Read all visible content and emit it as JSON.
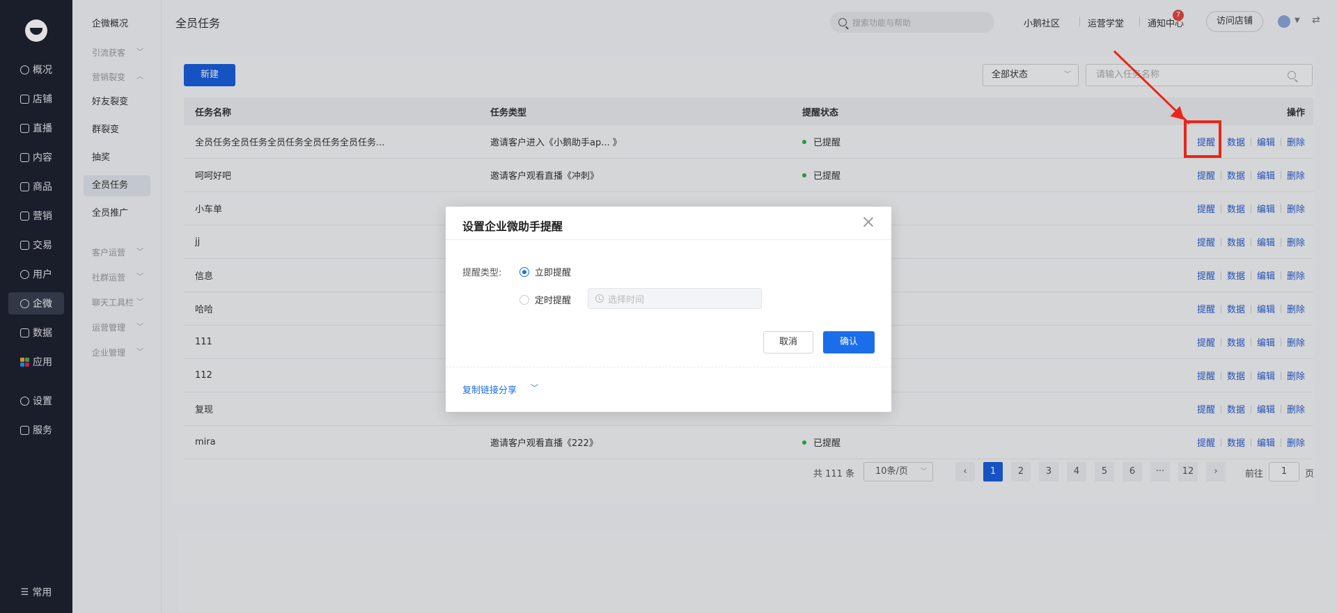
{
  "nav": {
    "items": [
      {
        "label": "概况",
        "icon": "pie-chart-icon"
      },
      {
        "label": "店铺",
        "icon": "store-icon"
      },
      {
        "label": "直播",
        "icon": "live-icon"
      },
      {
        "label": "内容",
        "icon": "document-icon"
      },
      {
        "label": "商品",
        "icon": "goods-icon"
      },
      {
        "label": "营销",
        "icon": "megaphone-icon"
      },
      {
        "label": "交易",
        "icon": "transaction-icon"
      },
      {
        "label": "用户",
        "icon": "user-icon"
      },
      {
        "label": "企微",
        "icon": "wecom-icon"
      },
      {
        "label": "数据",
        "icon": "data-icon"
      },
      {
        "label": "应用",
        "icon": "apps-icon"
      },
      {
        "label": "设置",
        "icon": "gear-icon"
      },
      {
        "label": "服务",
        "icon": "service-icon"
      }
    ],
    "bottom": {
      "label": "常用",
      "icon": "list-icon"
    },
    "active_label": "企微",
    "apps_colors": [
      "#f5a623",
      "#4caf50",
      "#2196f3",
      "#e91e63"
    ]
  },
  "subnav": {
    "items": [
      {
        "label": "企微概况",
        "type": "link"
      },
      {
        "label": "引流获客",
        "type": "group"
      },
      {
        "label": "营销裂变",
        "type": "group"
      },
      {
        "label": "好友裂变",
        "type": "link"
      },
      {
        "label": "群裂变",
        "type": "link"
      },
      {
        "label": "抽奖",
        "type": "link"
      },
      {
        "label": "全员任务",
        "type": "link",
        "active": true
      },
      {
        "label": "全员推广",
        "type": "link"
      },
      {
        "label": "客户运营",
        "type": "group"
      },
      {
        "label": "社群运营",
        "type": "group"
      },
      {
        "label": "聊天工具栏",
        "type": "group"
      },
      {
        "label": "运营管理",
        "type": "group"
      },
      {
        "label": "企业管理",
        "type": "group"
      }
    ]
  },
  "header": {
    "title": "全员任务",
    "search_placeholder": "搜索功能与帮助",
    "links": [
      "小鹅社区",
      "运营学堂",
      "通知中心"
    ],
    "notification_count": "7",
    "visit_store": "访问店铺"
  },
  "toolbar": {
    "new_label": "新建",
    "status_value": "全部状态",
    "name_placeholder": "请输入任务名称"
  },
  "table": {
    "headers": [
      "任务名称",
      "任务类型",
      "提醒状态",
      "操作"
    ],
    "actions": [
      "提醒",
      "数据",
      "编辑",
      "删除"
    ],
    "rows": [
      {
        "name": "全员任务全员任务全员任务全员任务全员任务...",
        "type": "邀请客户进入《小鹅助手ap... 》",
        "status": "已提醒"
      },
      {
        "name": "呵呵好吧",
        "type": "邀请客户观看直播《冲刺》",
        "status": "已提醒"
      },
      {
        "name": "小车单",
        "type": "",
        "status": ""
      },
      {
        "name": "jj",
        "type": "",
        "status": ""
      },
      {
        "name": "信息",
        "type": "",
        "status": ""
      },
      {
        "name": "哈哈",
        "type": "",
        "status": ""
      },
      {
        "name": "111",
        "type": "",
        "status": ""
      },
      {
        "name": "112",
        "type": "",
        "status": ""
      },
      {
        "name": "复现",
        "type": "",
        "status": ""
      },
      {
        "name": "mira",
        "type": "邀请客户观看直播《222》",
        "status": "已提醒"
      }
    ]
  },
  "pagination": {
    "total": "共 111 条",
    "page_size": "10条/页",
    "prev": "‹",
    "next": "›",
    "pages": [
      "1",
      "2",
      "3",
      "4",
      "5",
      "6",
      "···",
      "12"
    ],
    "current": "1",
    "goto_label": "前往",
    "goto_value": "1",
    "goto_unit": "页"
  },
  "modal": {
    "title": "设置企业微助手提醒",
    "field_label": "提醒类型:",
    "option_immediate": "立即提醒",
    "option_scheduled": "定时提醒",
    "time_placeholder": "选择时间",
    "cancel": "取消",
    "confirm": "确认",
    "share_link": "复制链接分享"
  },
  "colors": {
    "primary": "#1a5edc",
    "annotation": "#e8261b",
    "status_dot": "#34a853"
  }
}
